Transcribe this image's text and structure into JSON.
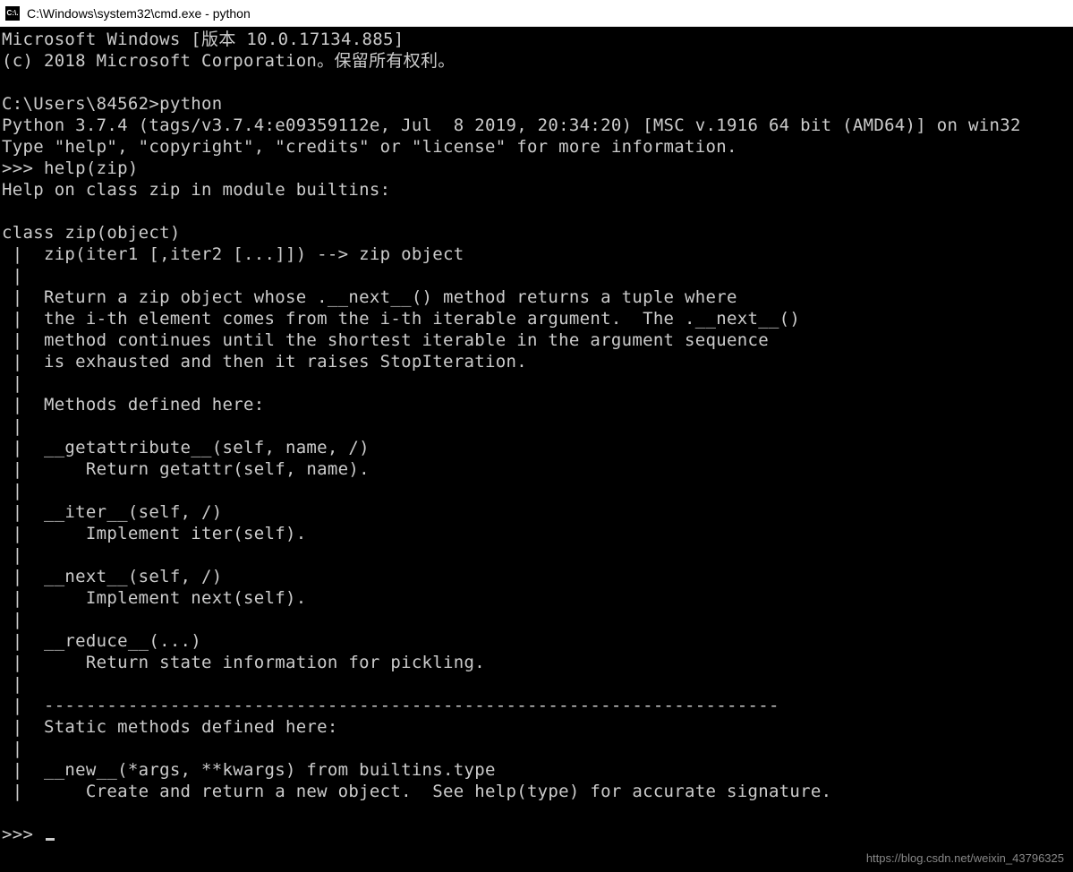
{
  "titlebar": {
    "icon_text": "C:\\.",
    "title": "C:\\Windows\\system32\\cmd.exe - python"
  },
  "terminal": {
    "line_01": "Microsoft Windows [版本 10.0.17134.885]",
    "line_02": "(c) 2018 Microsoft Corporation。保留所有权利。",
    "line_03": "",
    "line_04a": "C:\\Users\\84562>",
    "line_04b": "python",
    "line_05": "Python 3.7.4 (tags/v3.7.4:e09359112e, Jul  8 2019, 20:34:20) [MSC v.1916 64 bit (AMD64)] on win32",
    "line_06": "Type \"help\", \"copyright\", \"credits\" or \"license\" for more information.",
    "line_07a": ">>> ",
    "line_07b": "help(zip)",
    "line_08": "Help on class zip in module builtins:",
    "line_09": "",
    "line_10": "class zip(object)",
    "line_11": " |  zip(iter1 [,iter2 [...]]) --> zip object",
    "line_12": " |",
    "line_13": " |  Return a zip object whose .__next__() method returns a tuple where",
    "line_14": " |  the i-th element comes from the i-th iterable argument.  The .__next__()",
    "line_15": " |  method continues until the shortest iterable in the argument sequence",
    "line_16": " |  is exhausted and then it raises StopIteration.",
    "line_17": " |",
    "line_18": " |  Methods defined here:",
    "line_19": " |",
    "line_20": " |  __getattribute__(self, name, /)",
    "line_21": " |      Return getattr(self, name).",
    "line_22": " |",
    "line_23": " |  __iter__(self, /)",
    "line_24": " |      Implement iter(self).",
    "line_25": " |",
    "line_26": " |  __next__(self, /)",
    "line_27": " |      Implement next(self).",
    "line_28": " |",
    "line_29": " |  __reduce__(...)",
    "line_30": " |      Return state information for pickling.",
    "line_31": " |",
    "line_32": " |  ----------------------------------------------------------------------",
    "line_33": " |  Static methods defined here:",
    "line_34": " |",
    "line_35": " |  __new__(*args, **kwargs) from builtins.type",
    "line_36": " |      Create and return a new object.  See help(type) for accurate signature.",
    "line_37": "",
    "prompt": ">>> "
  },
  "watermark": "https://blog.csdn.net/weixin_43796325"
}
